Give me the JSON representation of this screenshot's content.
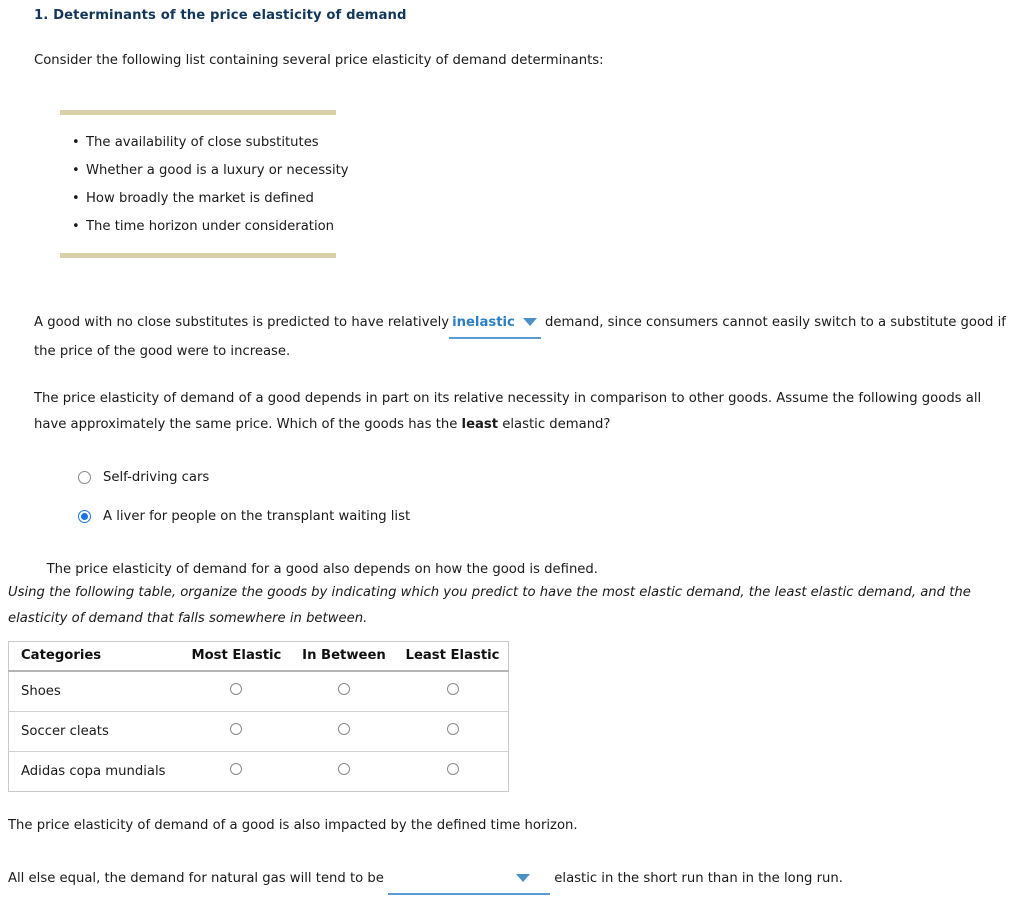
{
  "question": {
    "number_and_title": "1. Determinants of the price elasticity of demand",
    "intro": "Consider the following list containing several price elasticity of demand determinants:"
  },
  "determinants_list": {
    "items": [
      "The availability of close substitutes",
      "Whether a good is a luxury or necessity",
      "How broadly the market is defined",
      "The time horizon under consideration"
    ]
  },
  "substitutes_paragraph": {
    "before_dropdown": "A good with no close substitutes is predicted to have relatively",
    "after_dropdown": "demand, since consumers cannot easily switch to a substitute good if the price of the good were to increase."
  },
  "dropdown_elasticity": {
    "value": "inelastic",
    "arrow_icon": "chevron-down-icon"
  },
  "necessity_paragraph": {
    "part1": "The price elasticity of demand of a good depends in part on its relative necessity in comparison to other goods. Assume the following goods all have approximately the same price. Which of the goods has the",
    "emphasis": "least",
    "part2": "elastic demand?"
  },
  "goods_options": [
    {
      "label": "Self-driving cars",
      "selected": false
    },
    {
      "label": "A liver for people on the transplant waiting list",
      "selected": true
    }
  ],
  "defined_paragraph": {
    "text": "The price elasticity of demand for a good also depends on how the good is defined."
  },
  "instruction_italic": {
    "text": "Using the following table, organize the goods by indicating which you predict to have the most elastic demand, the least elastic demand, and the elasticity of demand that falls somewhere in between."
  },
  "elasticity_table": {
    "headers": [
      "Categories",
      "Most Elastic",
      "In Between",
      "Least Elastic"
    ],
    "rows": [
      {
        "category": "Shoes",
        "most_elastic": false,
        "in_between": false,
        "least_elastic": false
      },
      {
        "category": "Soccer cleats",
        "most_elastic": false,
        "in_between": false,
        "least_elastic": false
      },
      {
        "category": "Adidas copa mundials",
        "most_elastic": false,
        "in_between": false,
        "least_elastic": false
      }
    ]
  },
  "time_horizon_paragraph": {
    "text": "The price elasticity of demand of a good is also impacted by the defined time horizon."
  },
  "natural_gas_sentence": {
    "before_dropdown": "All else equal, the demand for natural gas will tend to be",
    "after_dropdown": "elastic in the short run than in the long run."
  },
  "dropdown_natural_gas": {
    "value": "",
    "arrow_icon": "chevron-down-icon"
  },
  "colors": {
    "heading": "#13375b",
    "rule_tan": "#d9cfa8",
    "dropdown_blue": "#2d7fc1",
    "dropdown_underline": "#5b9bd5",
    "radio_selected": "#1a73e8"
  }
}
